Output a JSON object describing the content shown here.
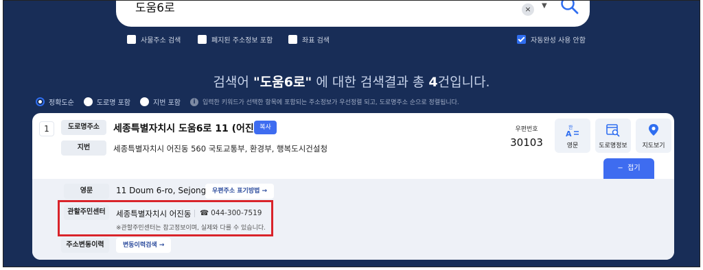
{
  "search": {
    "query": "도움6로",
    "clear": "×"
  },
  "options": [
    {
      "label": "사물주소 검색",
      "checked": false
    },
    {
      "label": "폐지된 주소정보 포함",
      "checked": false
    },
    {
      "label": "좌표 검색",
      "checked": false
    },
    {
      "label": "자동완성 사용 안함",
      "checked": true
    }
  ],
  "heading": {
    "prefix": "검색어 ",
    "query": "\"도움6로\"",
    "middle": " 에 대한 검색결과 총 ",
    "count": "4",
    "suffix": "건입니다."
  },
  "sort": {
    "items": [
      {
        "label": "정확도순",
        "selected": true
      },
      {
        "label": "도로명 포함",
        "selected": false
      },
      {
        "label": "지번 포함",
        "selected": false
      }
    ],
    "info": "i",
    "note": "입력한 키워드가 선택한 항목에 포함되는 주소정보가 우선정렬 되고, 도로명주소 순으로 정렬됩니다."
  },
  "result": {
    "index": "1",
    "road_tag": "도로명주소",
    "road_address": "세종특별자치시 도움6로 11 (어진동)",
    "copy_label": "복사",
    "jibun_tag": "지번",
    "jibun_address": "세종특별자치시 어진동 560 국토교통부, 환경부, 행복도시건설청",
    "zip_label": "우편번호",
    "zip_code": "30103",
    "tools": [
      {
        "label": "영문",
        "icon": "english-translate-icon"
      },
      {
        "label": "도로명정보",
        "icon": "road-info-icon"
      },
      {
        "label": "지도보기",
        "icon": "map-pin-icon"
      }
    ],
    "fold_label": "접기",
    "fold_icon": "−",
    "eng_tag": "영문",
    "eng_address": "11 Doum 6-ro, Sejong-si",
    "eng_link": "우편주소 표기방법 →",
    "center_tag": "관할주민센터",
    "center_name": "세종특별자치시 어진동",
    "center_phone": "044-300-7519",
    "center_note": "※관할주민센터는 참고정보이며, 실제와 다를 수 있습니다.",
    "history_tag": "주소변동이력",
    "history_link": "변동이력검색 →"
  },
  "colors": {
    "background": "#182d57",
    "accent": "#3e6cf0",
    "highlight": "#d9232a"
  }
}
